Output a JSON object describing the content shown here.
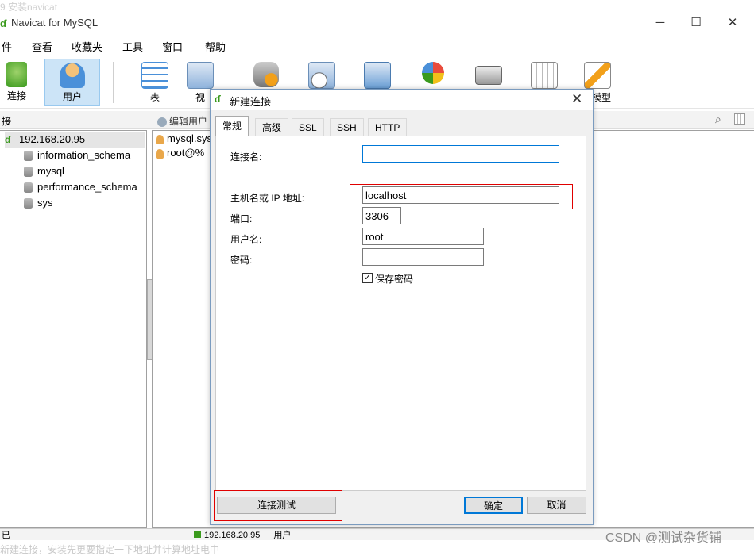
{
  "window": {
    "title": "Navicat for MySQL",
    "minimize_glyph": "─",
    "maximize_glyph": "☐",
    "close_glyph": "✕",
    "top_faded_text": "9 安装navicat"
  },
  "menu": [
    "件",
    "查看",
    "收藏夹",
    "工具",
    "窗口",
    "帮助"
  ],
  "toolbar": {
    "buttons": [
      {
        "label": "连接",
        "icon": "connect-icon"
      },
      {
        "label": "用户",
        "icon": "user-icon"
      },
      {
        "label": "表",
        "icon": "table-icon"
      },
      {
        "label": "视",
        "icon": "view-icon"
      },
      {
        "label": "",
        "icon": "function-icon"
      },
      {
        "label": "",
        "icon": "event-icon"
      },
      {
        "label": "",
        "icon": "query-icon"
      },
      {
        "label": "",
        "icon": "report-icon"
      },
      {
        "label": "",
        "icon": "backup-icon"
      },
      {
        "label": "",
        "icon": "schedule-icon"
      },
      {
        "label": "模型",
        "icon": "model-icon"
      }
    ]
  },
  "subbar": {
    "left_label": "接",
    "edit_user_label": "编辑用户"
  },
  "tree": {
    "connection": "192.168.20.95",
    "databases": [
      "information_schema",
      "mysql",
      "performance_schema",
      "sys"
    ]
  },
  "users": [
    "mysql.sys",
    "root@%"
  ],
  "status": {
    "left": "已",
    "connection_text": "192.168.20.95",
    "user_text": "用户"
  },
  "watermark": "CSDN @测试杂货铺",
  "bottom_faded": "新建连接，安装先更要指定一下地址并计算地址电中",
  "dialog": {
    "title": "新建连接",
    "close_glyph": "✕",
    "tabs": [
      "常规",
      "高级",
      "SSL",
      "SSH",
      "HTTP"
    ],
    "fields": {
      "connection_name_label": "连接名:",
      "connection_name_value": "",
      "host_label": "主机名或 IP 地址:",
      "host_value": "localhost",
      "port_label": "端口:",
      "port_value": "3306",
      "user_label": "用户名:",
      "user_value": "root",
      "password_label": "密码:",
      "password_value": "",
      "save_password_label": "保存密码",
      "save_password_checked": true,
      "check_glyph": "✓"
    },
    "buttons": {
      "test": "连接测试",
      "ok": "确定",
      "cancel": "取消"
    },
    "highlight_color": "#e00000"
  }
}
